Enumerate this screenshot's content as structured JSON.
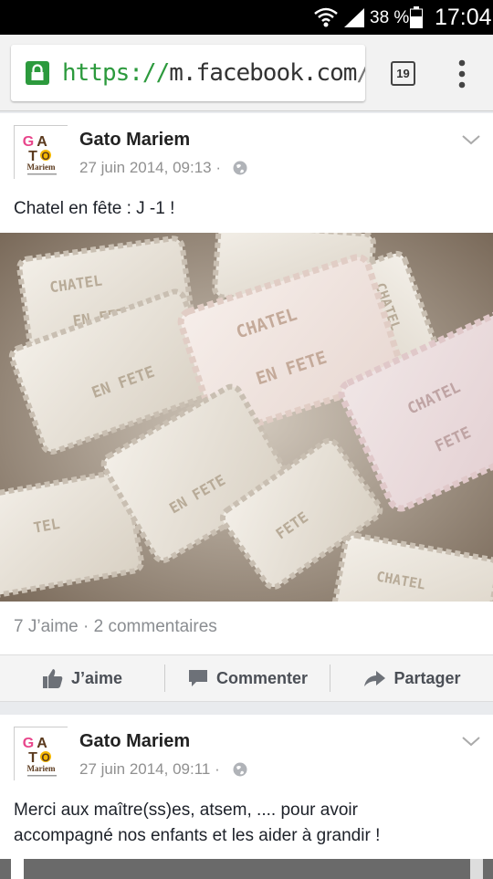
{
  "status_bar": {
    "battery": "38 %",
    "time": "17:04"
  },
  "browser": {
    "url_scheme": "https://",
    "url_host": "m.facebook.com",
    "url_path": "/pag",
    "tab_count": "19"
  },
  "posts": [
    {
      "author": "Gato Mariem",
      "date": "27 juin 2014, 09:13 ·",
      "text": "Chatel en fête : J -1 !",
      "photo_stamps": [
        "CHATEL",
        "EN FETE",
        "CHATEL",
        "EN FETE",
        "CHATEL",
        "EN FETE",
        "CHATEL",
        "FETE",
        "TEL",
        "EN FETE",
        "FETE",
        "CHATEL"
      ],
      "counts": "7 J’aime · 2 commentaires",
      "actions": {
        "like": "J’aime",
        "comment": "Commenter",
        "share": "Partager"
      }
    },
    {
      "author": "Gato Mariem",
      "date": "27 juin 2014, 09:11 ·",
      "text_line1": "Merci aux maître(ss)es, atsem, .... pour avoir",
      "text_line2": "accompagné nos enfants et les aider à grandir !"
    }
  ],
  "avatar_logo": {
    "letters": [
      "G",
      "A",
      "T",
      "O"
    ],
    "word": "Mariem",
    "colors": [
      "#e8458b",
      "#5b3a1e",
      "#f5b800",
      "#5b3a1e"
    ]
  }
}
